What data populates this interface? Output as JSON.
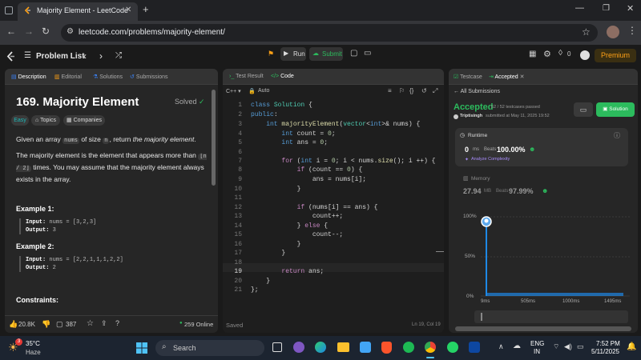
{
  "browser": {
    "tab_title": "Majority Element - LeetCode",
    "url": "leetcode.com/problems/majority-element/"
  },
  "nav": {
    "problem_list": "Problem List",
    "run": "Run",
    "submit": "Submit",
    "streak": "0",
    "premium": "Premium"
  },
  "left_panel": {
    "tabs": [
      "Description",
      "Editorial",
      "Solutions",
      "Submissions"
    ],
    "title": "169. Majority Element",
    "solved": "Solved",
    "chips": [
      "Easy",
      "Topics",
      "Companies"
    ],
    "p1_a": "Given an array",
    "p1_code": "nums",
    "p1_b": "of size",
    "p1_code2": "n",
    "p1_c": ", return",
    "p1_em": "the majority element",
    "p1_d": ".",
    "p2_a": "The majority element is the element that appears more than",
    "p2_code": "⌊n / 2⌋",
    "p2_b": "times. You may assume that the majority element always exists in the array.",
    "ex1_title": "Example 1:",
    "ex1_input_label": "Input:",
    "ex1_input": "nums = [3,2,3]",
    "ex1_output_label": "Output:",
    "ex1_output": "3",
    "ex2_title": "Example 2:",
    "ex2_input_label": "Input:",
    "ex2_input": "nums = [2,2,1,1,1,2,2]",
    "ex2_output_label": "Output:",
    "ex2_output": "2",
    "constraints": "Constraints:",
    "likes": "20.8K",
    "comments": "387",
    "online": "259 Online"
  },
  "code_panel": {
    "tabs": [
      "Test Result",
      "Code"
    ],
    "lang": "C++",
    "mode": "Auto",
    "saved": "Saved",
    "cursor": "Ln 19, Col 19",
    "line_numbers": [
      "1",
      "2",
      "3",
      "4",
      "5",
      "6",
      "7",
      "8",
      "9",
      "10",
      "11",
      "12",
      "13",
      "14",
      "15",
      "16",
      "17",
      "18",
      "19",
      "20",
      "21"
    ]
  },
  "right_panel": {
    "tabs": [
      "Testcase",
      "Accepted"
    ],
    "all_submissions": "All Submissions",
    "accepted": "Accepted",
    "passed": "52 / 52 testcases passed",
    "user": "Triptisingh",
    "submitted": "submitted at May 11, 2025 19:52",
    "solution_btn": "Solution",
    "runtime_label": "Runtime",
    "runtime_value": "0",
    "runtime_unit": "ms",
    "beats_label": "Beats",
    "runtime_beats": "100.00%",
    "analyze": "Analyze Complexity",
    "memory_label": "Memory",
    "memory_value": "27.94",
    "memory_unit": "MB",
    "memory_beats": "97.99%",
    "y_ticks": [
      "100%",
      "50%",
      "0%"
    ],
    "x_ticks": [
      "9ms",
      "505ms",
      "1000ms",
      "1495ms"
    ]
  },
  "taskbar": {
    "temp": "35°C",
    "weather": "Haze",
    "badge": "3",
    "search": "Search",
    "lang1": "ENG",
    "lang2": "IN",
    "time": "7:52 PM",
    "date": "5/11/2025"
  },
  "colors": {
    "accent_green": "#2cbb5d",
    "premium": "#ffa116",
    "chart_blue": "#1e88e5"
  }
}
